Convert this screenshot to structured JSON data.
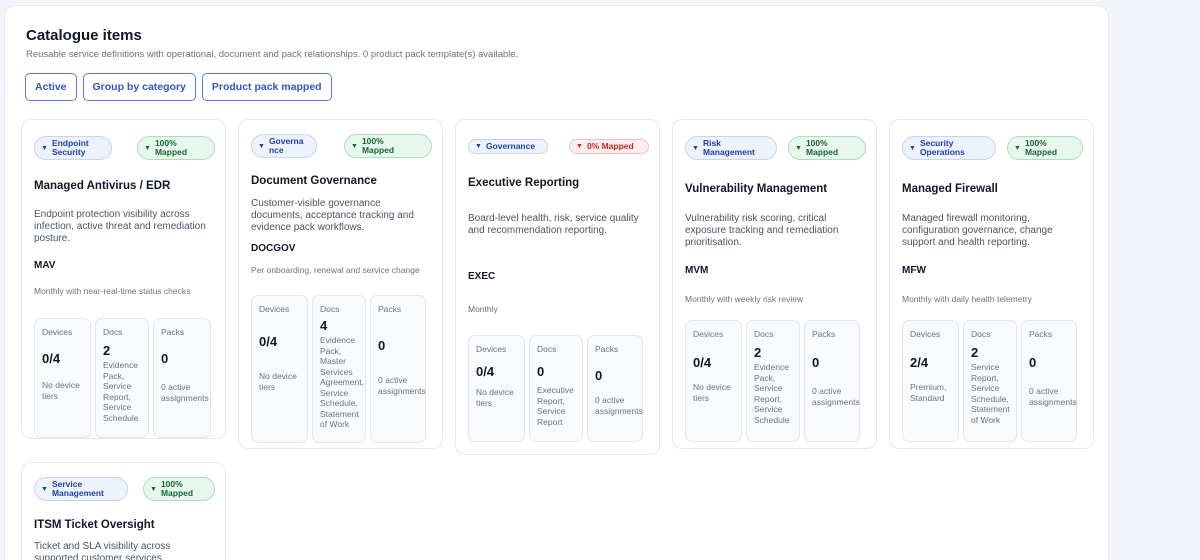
{
  "page": {
    "title": "Catalogue items",
    "subtitle": "Reusable service definitions with operational, document and pack relationships. 0 product pack template(s) available."
  },
  "filters": [
    {
      "label": "Active"
    },
    {
      "label": "Group by category"
    },
    {
      "label": "Product pack mapped"
    }
  ],
  "stat_labels": {
    "devices": "Devices",
    "docs": "Docs",
    "packs": "Packs"
  },
  "colors": {
    "accent": "#2f55c8",
    "mapped": "#166534",
    "unmapped": "#c62828"
  },
  "cards": [
    {
      "category": "Endpoint Security",
      "mapped": "100% Mapped",
      "name": "Managed Antivirus / EDR",
      "description": "Endpoint protection visibility across infection, active threat and remediation posture.",
      "code": "MAV",
      "frequency": "Monthly with near-real-time status checks",
      "devices": {
        "value": "0/4",
        "detail": "No device tiers"
      },
      "docs": {
        "value": "2",
        "detail": "Evidence Pack, Service Report, Service Schedule"
      },
      "packs": {
        "value": "0",
        "detail": "0 active assignments"
      }
    },
    {
      "category": "Governance",
      "mapped": "100% Mapped",
      "name": "Document Governance",
      "description": "Customer-visible governance documents, acceptance tracking and evidence pack workflows.",
      "code": "DOCGOV",
      "frequency": "Per onboarding, renewal and service change",
      "devices": {
        "value": "0/4",
        "detail": "No device tiers"
      },
      "docs": {
        "value": "4",
        "detail": "Evidence Pack, Master Services Agreement, Service Schedule, Statement of Work"
      },
      "packs": {
        "value": "0",
        "detail": "0 active assignments"
      }
    },
    {
      "category": "Governance",
      "mapped": "0% Mapped",
      "name": "Executive Reporting",
      "description": "Board-level health, risk, service quality and recommendation reporting.",
      "code": "EXEC",
      "frequency": "Monthly",
      "devices": {
        "value": "0/4",
        "detail": "No device tiers"
      },
      "docs": {
        "value": "0",
        "detail": "Executive Report, Service Report"
      },
      "packs": {
        "value": "0",
        "detail": "0 active assignments"
      }
    },
    {
      "category": "Risk Management",
      "mapped": "100% Mapped",
      "name": "Vulnerability Management",
      "description": "Vulnerability risk scoring, critical exposure tracking and remediation prioritisation.",
      "code": "MVM",
      "frequency": "Monthly with weekly risk review",
      "devices": {
        "value": "0/4",
        "detail": "No device tiers"
      },
      "docs": {
        "value": "2",
        "detail": "Evidence Pack, Service Report, Service Schedule"
      },
      "packs": {
        "value": "0",
        "detail": "0 active assignments"
      }
    },
    {
      "category": "Security Operations",
      "mapped": "100% Mapped",
      "name": "Managed Firewall",
      "description": "Managed firewall monitoring, configuration governance, change support and health reporting.",
      "code": "MFW",
      "frequency": "Monthly with daily health telemetry",
      "devices": {
        "value": "2/4",
        "detail": "Premium, Standard"
      },
      "docs": {
        "value": "2",
        "detail": "Service Report, Service Schedule, Statement of Work"
      },
      "packs": {
        "value": "0",
        "detail": "0 active assignments"
      }
    },
    {
      "category": "Service Management",
      "mapped": "100% Mapped",
      "name": "ITSM Ticket Oversight",
      "description": "Ticket and SLA visibility across supported customer services."
    }
  ]
}
